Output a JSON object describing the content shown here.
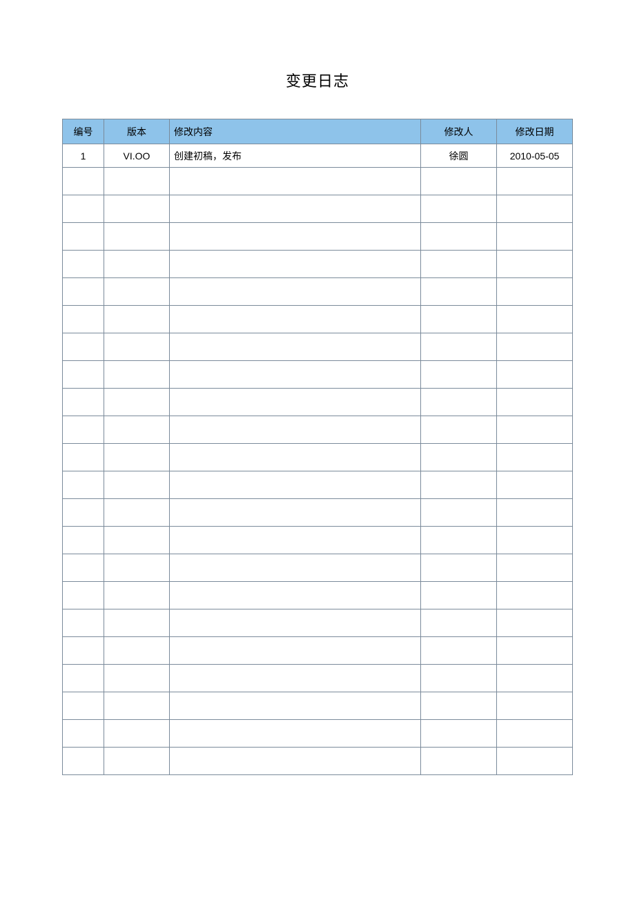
{
  "title": "变更日志",
  "headers": {
    "id": "编号",
    "version": "版本",
    "description": "修改内容",
    "modifier": "修改人",
    "date": "修改日期"
  },
  "rows": [
    {
      "id": "1",
      "version": "VI.OO",
      "description": "创建初稿，发布",
      "modifier": "徐圆",
      "date": "2010-05-05"
    },
    {
      "id": "",
      "version": "",
      "description": "",
      "modifier": "",
      "date": ""
    },
    {
      "id": "",
      "version": "",
      "description": "",
      "modifier": "",
      "date": ""
    },
    {
      "id": "",
      "version": "",
      "description": "",
      "modifier": "",
      "date": ""
    },
    {
      "id": "",
      "version": "",
      "description": "",
      "modifier": "",
      "date": ""
    },
    {
      "id": "",
      "version": "",
      "description": "",
      "modifier": "",
      "date": ""
    },
    {
      "id": "",
      "version": "",
      "description": "",
      "modifier": "",
      "date": ""
    },
    {
      "id": "",
      "version": "",
      "description": "",
      "modifier": "",
      "date": ""
    },
    {
      "id": "",
      "version": "",
      "description": "",
      "modifier": "",
      "date": ""
    },
    {
      "id": "",
      "version": "",
      "description": "",
      "modifier": "",
      "date": ""
    },
    {
      "id": "",
      "version": "",
      "description": "",
      "modifier": "",
      "date": ""
    },
    {
      "id": "",
      "version": "",
      "description": "",
      "modifier": "",
      "date": ""
    },
    {
      "id": "",
      "version": "",
      "description": "",
      "modifier": "",
      "date": ""
    },
    {
      "id": "",
      "version": "",
      "description": "",
      "modifier": "",
      "date": ""
    },
    {
      "id": "",
      "version": "",
      "description": "",
      "modifier": "",
      "date": ""
    },
    {
      "id": "",
      "version": "",
      "description": "",
      "modifier": "",
      "date": ""
    },
    {
      "id": "",
      "version": "",
      "description": "",
      "modifier": "",
      "date": ""
    },
    {
      "id": "",
      "version": "",
      "description": "",
      "modifier": "",
      "date": ""
    },
    {
      "id": "",
      "version": "",
      "description": "",
      "modifier": "",
      "date": ""
    },
    {
      "id": "",
      "version": "",
      "description": "",
      "modifier": "",
      "date": ""
    },
    {
      "id": "",
      "version": "",
      "description": "",
      "modifier": "",
      "date": ""
    },
    {
      "id": "",
      "version": "",
      "description": "",
      "modifier": "",
      "date": ""
    },
    {
      "id": "",
      "version": "",
      "description": "",
      "modifier": "",
      "date": ""
    }
  ]
}
